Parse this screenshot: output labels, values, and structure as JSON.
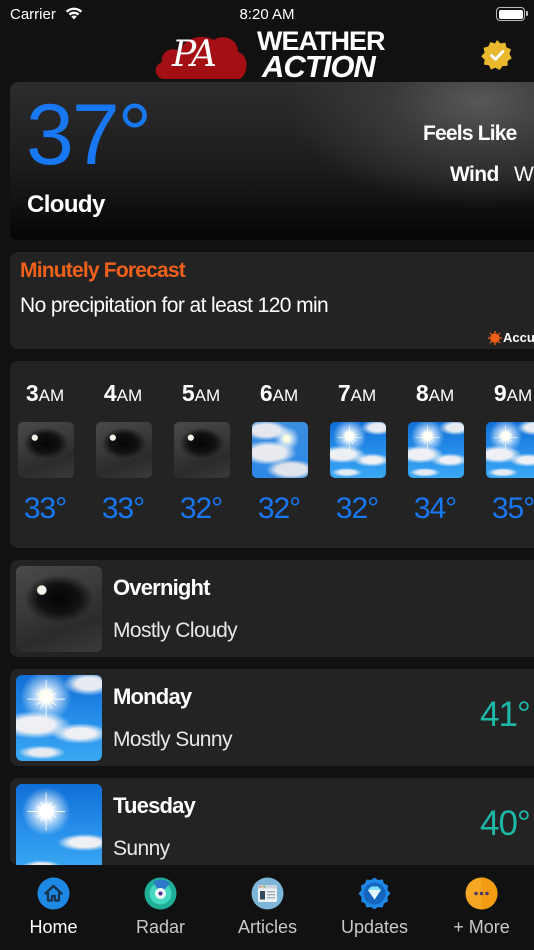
{
  "status_bar": {
    "carrier": "Carrier",
    "time": "8:20 AM",
    "wifi_icon": "wifi-icon",
    "battery_icon": "battery-full-icon"
  },
  "header": {
    "logo_monogram": "PA",
    "logo_line1": "WEATHER",
    "logo_line2": "ACTION",
    "logo_color": "#a30f12",
    "badge_icon": "verified-badge-icon",
    "badge_color": "#e8b92e"
  },
  "current": {
    "temperature": "37°",
    "condition": "Cloudy",
    "feels_like_label": "Feels Like",
    "wind_label": "Wind",
    "wind_value": "W",
    "temp_color": "#1877f2"
  },
  "minutely": {
    "title": "Minutely Forecast",
    "message": "No precipitation for at least 120 min",
    "provider": "Accu",
    "title_color": "#f0601b"
  },
  "hourly": [
    {
      "hour": "3",
      "ampm": "AM",
      "temp": "33°",
      "icon": "night-cloudy"
    },
    {
      "hour": "4",
      "ampm": "AM",
      "temp": "33°",
      "icon": "night-cloudy"
    },
    {
      "hour": "5",
      "ampm": "AM",
      "temp": "32°",
      "icon": "night-cloudy"
    },
    {
      "hour": "6",
      "ampm": "AM",
      "temp": "32°",
      "icon": "cloudy-sun"
    },
    {
      "hour": "7",
      "ampm": "AM",
      "temp": "32°",
      "icon": "sunny-clouds"
    },
    {
      "hour": "8",
      "ampm": "AM",
      "temp": "34°",
      "icon": "sunny-clouds"
    },
    {
      "hour": "9",
      "ampm": "AM",
      "temp": "35°",
      "icon": "sunny-clouds"
    }
  ],
  "daily": [
    {
      "name": "Overnight",
      "description": "Mostly Cloudy",
      "temp": "",
      "icon": "night-cloudy"
    },
    {
      "name": "Monday",
      "description": "Mostly Sunny",
      "temp": "41°",
      "icon": "sunny-clouds"
    },
    {
      "name": "Tuesday",
      "description": "Sunny",
      "temp": "40°",
      "icon": "clear-sunny"
    }
  ],
  "daily_temp_color": "#1cb8a6",
  "tab_bar": {
    "items": [
      {
        "label": "Home",
        "icon": "home-icon",
        "active": true
      },
      {
        "label": "Radar",
        "icon": "radar-icon",
        "active": false
      },
      {
        "label": "Articles",
        "icon": "articles-icon",
        "active": false
      },
      {
        "label": "Updates",
        "icon": "updates-diamond-icon",
        "active": false
      },
      {
        "label": "+ More",
        "icon": "more-icon",
        "active": false
      }
    ]
  }
}
